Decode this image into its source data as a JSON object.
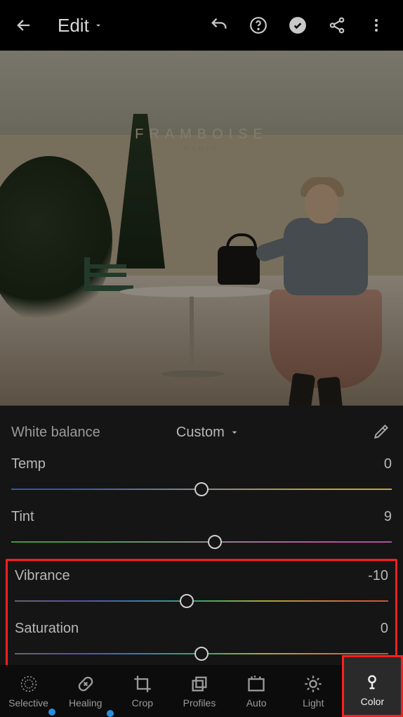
{
  "header": {
    "title": "Edit"
  },
  "photo": {
    "sign_text": "FRAMBOISE",
    "sign_sub": "PARIS"
  },
  "white_balance": {
    "label": "White balance",
    "mode": "Custom"
  },
  "sliders": {
    "temp": {
      "label": "Temp",
      "value": "0",
      "pos": 50
    },
    "tint": {
      "label": "Tint",
      "value": "9",
      "pos": 53.5
    },
    "vibrance": {
      "label": "Vibrance",
      "value": "-10",
      "pos": 46
    },
    "saturation": {
      "label": "Saturation",
      "value": "0",
      "pos": 50
    }
  },
  "tools": [
    {
      "label": "Selective"
    },
    {
      "label": "Healing"
    },
    {
      "label": "Crop"
    },
    {
      "label": "Profiles"
    },
    {
      "label": "Auto"
    },
    {
      "label": "Light"
    },
    {
      "label": "Color"
    }
  ]
}
